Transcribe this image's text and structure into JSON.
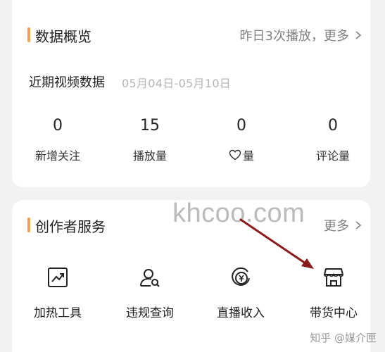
{
  "data_overview": {
    "title": "数据概览",
    "more_text": "昨日3次播放，更多",
    "subtitle": "近期视频数据",
    "date_range": "05月04日-05月10日",
    "stats": [
      {
        "value": "0",
        "label": "新增关注"
      },
      {
        "value": "15",
        "label": "播放量"
      },
      {
        "value": "0",
        "label": "量",
        "icon": "heart-outline-icon"
      },
      {
        "value": "0",
        "label": "评论量"
      }
    ]
  },
  "creator_services": {
    "title": "创作者服务",
    "more_text": "更多",
    "items": [
      {
        "label": "加热工具",
        "icon": "trend-chart-icon"
      },
      {
        "label": "违规查询",
        "icon": "user-search-icon"
      },
      {
        "label": "直播收入",
        "icon": "live-income-icon"
      },
      {
        "label": "带货中心",
        "icon": "storefront-icon"
      }
    ]
  },
  "watermark": "khcoo.com",
  "credit": "知乎 @媒介匣",
  "colors": {
    "accent": "#f0a24a",
    "arrow": "#8b1a1a",
    "background": "#f2f2f4",
    "card": "#ffffff",
    "muted_text": "#808080"
  }
}
